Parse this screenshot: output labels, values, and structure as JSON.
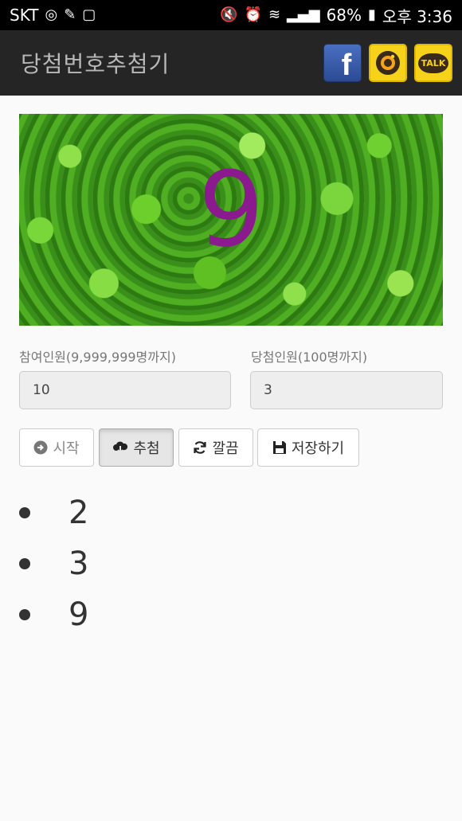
{
  "status_bar": {
    "carrier": "SKT",
    "battery": "68%",
    "time": "오후 3:36"
  },
  "app_bar": {
    "title": "당첨번호추첨기",
    "share": {
      "facebook_icon": "facebook-icon",
      "kakaostory_icon": "kakaostory-icon",
      "kakaotalk_label": "TALK"
    }
  },
  "hero": {
    "current_number": "9"
  },
  "form": {
    "participants_label": "참여인원(9,999,999명까지)",
    "participants_value": "10",
    "winners_label": "당첨인원(100명까지)",
    "winners_value": "3"
  },
  "buttons": {
    "start_label": "시작",
    "draw_label": "추첨",
    "clear_label": "깔끔",
    "save_label": "저장하기"
  },
  "results": [
    "2",
    "3",
    "9"
  ],
  "colors": {
    "appbar_bg": "#252525",
    "number_color": "#8b1a8e"
  }
}
